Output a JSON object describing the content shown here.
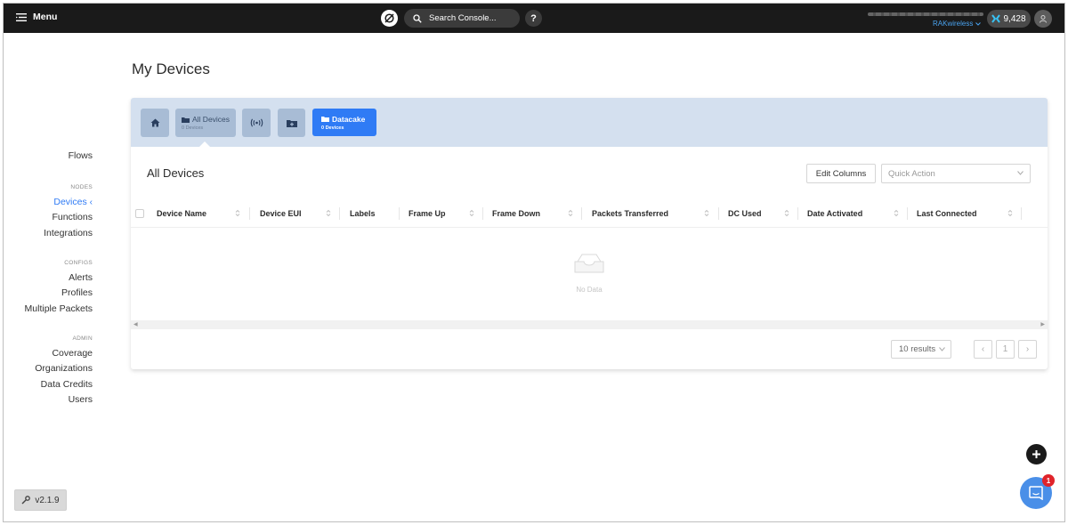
{
  "topbar": {
    "menu_label": "Menu",
    "search_placeholder": "Search Console...",
    "help_label": "?",
    "org_name": "RAKwireless",
    "credits": "9,428"
  },
  "sidebar": {
    "top_items": [
      {
        "label": "Flows"
      }
    ],
    "nodes": {
      "heading": "NODES",
      "items": [
        {
          "label": "Devices",
          "active": true
        },
        {
          "label": "Functions"
        },
        {
          "label": "Integrations"
        }
      ]
    },
    "configs": {
      "heading": "CONFIGS",
      "items": [
        {
          "label": "Alerts"
        },
        {
          "label": "Profiles"
        },
        {
          "label": "Multiple Packets"
        }
      ]
    },
    "admin": {
      "heading": "ADMIN",
      "items": [
        {
          "label": "Coverage"
        },
        {
          "label": "Organizations"
        },
        {
          "label": "Data Credits"
        },
        {
          "label": "Users"
        }
      ]
    },
    "version": "v2.1.9"
  },
  "main": {
    "title": "My Devices",
    "tiles": {
      "all_devices": {
        "label": "All Devices",
        "count": "0 Devices"
      },
      "datacake": {
        "label": "Datacake",
        "count": "0 Devices"
      }
    },
    "section_title": "All Devices",
    "edit_columns": "Edit Columns",
    "quick_action_placeholder": "Quick Action",
    "columns": [
      "Device Name",
      "Device EUI",
      "Labels",
      "Frame Up",
      "Frame Down",
      "Packets Transferred",
      "DC Used",
      "Date Activated",
      "Last Connected"
    ],
    "empty_text": "No Data",
    "results_select": "10 results",
    "pagination": {
      "current": "1"
    }
  },
  "chat_badge": "1",
  "colors": {
    "accent": "#2f7bf5",
    "topbar": "#1a1a1a",
    "tile_bg": "#a8bcd5",
    "header_band": "#d4e0ef"
  }
}
